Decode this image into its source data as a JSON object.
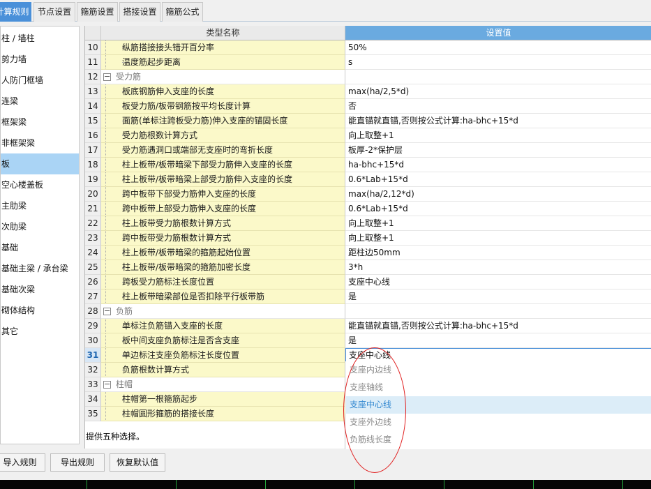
{
  "tabs": [
    {
      "label": "计算规则",
      "active": true
    },
    {
      "label": "节点设置",
      "active": false
    },
    {
      "label": "箍筋设置",
      "active": false
    },
    {
      "label": "搭接设置",
      "active": false
    },
    {
      "label": "箍筋公式",
      "active": false
    }
  ],
  "sidebar": {
    "items": [
      "柱 / 墙柱",
      "剪力墙",
      "人防门框墙",
      "连梁",
      "框架梁",
      "非框架梁",
      "板",
      "空心楼盖板",
      "主肋梁",
      "次肋梁",
      "基础",
      "基础主梁 / 承台梁",
      "基础次梁",
      "砌体结构",
      "其它"
    ],
    "selected_label": "板"
  },
  "grid": {
    "header": {
      "name": "类型名称",
      "value": "设置值"
    },
    "rows": [
      {
        "num": "10",
        "name": "纵筋搭接接头错开百分率",
        "value": "50%"
      },
      {
        "num": "11",
        "name": "温度筋起步距离",
        "value": "s"
      },
      {
        "num": "12",
        "name": "受力筋",
        "value": "",
        "group": true
      },
      {
        "num": "13",
        "name": "板底钢筋伸入支座的长度",
        "value": "max(ha/2,5*d)"
      },
      {
        "num": "14",
        "name": "板受力筋/板带钢筋按平均长度计算",
        "value": "否"
      },
      {
        "num": "15",
        "name": "面筋(单标注跨板受力筋)伸入支座的锚固长度",
        "value": "能直锚就直锚,否则按公式计算:ha-bhc+15*d"
      },
      {
        "num": "16",
        "name": "受力筋根数计算方式",
        "value": "向上取整+1"
      },
      {
        "num": "17",
        "name": "受力筋遇洞口或端部无支座时的弯折长度",
        "value": "板厚-2*保护层"
      },
      {
        "num": "18",
        "name": "柱上板带/板带暗梁下部受力筋伸入支座的长度",
        "value": "ha-bhc+15*d"
      },
      {
        "num": "19",
        "name": "柱上板带/板带暗梁上部受力筋伸入支座的长度",
        "value": "0.6*Lab+15*d"
      },
      {
        "num": "20",
        "name": "跨中板带下部受力筋伸入支座的长度",
        "value": "max(ha/2,12*d)"
      },
      {
        "num": "21",
        "name": "跨中板带上部受力筋伸入支座的长度",
        "value": "0.6*Lab+15*d"
      },
      {
        "num": "22",
        "name": "柱上板带受力筋根数计算方式",
        "value": "向上取整+1"
      },
      {
        "num": "23",
        "name": "跨中板带受力筋根数计算方式",
        "value": "向上取整+1"
      },
      {
        "num": "24",
        "name": "柱上板带/板带暗梁的箍筋起始位置",
        "value": "距柱边50mm"
      },
      {
        "num": "25",
        "name": "柱上板带/板带暗梁的箍筋加密长度",
        "value": "3*h"
      },
      {
        "num": "26",
        "name": "跨板受力筋标注长度位置",
        "value": "支座中心线"
      },
      {
        "num": "27",
        "name": "柱上板带暗梁部位是否扣除平行板带筋",
        "value": "是"
      },
      {
        "num": "28",
        "name": "负筋",
        "value": "",
        "group": true
      },
      {
        "num": "29",
        "name": "单标注负筋锚入支座的长度",
        "value": "能直锚就直锚,否则按公式计算:ha-bhc+15*d"
      },
      {
        "num": "30",
        "name": "板中间支座负筋标注是否含支座",
        "value": "是"
      },
      {
        "num": "31",
        "name": "单边标注支座负筋标注长度位置",
        "value": "支座中心线",
        "current": true
      },
      {
        "num": "32",
        "name": "负筋根数计算方式",
        "value": ""
      },
      {
        "num": "33",
        "name": "柱帽",
        "value": "",
        "group": true
      },
      {
        "num": "34",
        "name": "柱帽第一根箍筋起步",
        "value": ""
      },
      {
        "num": "35",
        "name": "柱帽圆形箍筋的搭接长度",
        "value": ""
      }
    ]
  },
  "dropdown": {
    "options": [
      "支座内边线",
      "支座轴线",
      "支座中心线",
      "支座外边线",
      "负筋线长度"
    ],
    "highlighted": "支座中心线"
  },
  "description": "提供五种选择。",
  "buttons": {
    "import": "导入规则",
    "export": "导出规则",
    "reset": "恢复默认值"
  },
  "colors": {
    "accent": "#4a90d9",
    "name_cell_bg": "#fbf9c9",
    "header_value_bg": "#6aaae0",
    "annotation": "#e02020"
  }
}
